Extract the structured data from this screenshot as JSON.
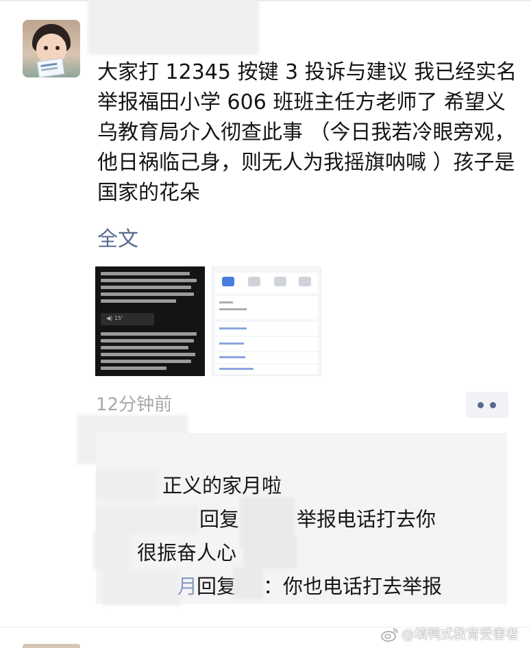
{
  "post": {
    "text": "大家打 12345 按键 3 投诉与建议 我已经实名举报福田小学 606 班班主任方老师了 希望义乌教育局介入彻查此事 （今日我若冷眼旁观，他日祸临己身，则无人为我摇旗呐喊 ）孩子是国家的花朵",
    "full_text_link": "全文",
    "time": "12分钟前"
  },
  "comments": {
    "line1": "正义的家月啦",
    "line2_reply": "回复",
    "line2_text": "举报电话打去你",
    "line3": "很振奋人心",
    "line4_frag": "月",
    "line4_reply": "回复",
    "line4_text": "：你也电话打去举报"
  },
  "watermark": {
    "text": "@填鸭式教育受害者"
  },
  "colors": {
    "link": "#57698f",
    "time": "#a8a8a8",
    "comment_bg": "#f4f4f6"
  },
  "icons": {
    "more": "more-dots-icon",
    "weibo": "weibo-logo-icon"
  }
}
